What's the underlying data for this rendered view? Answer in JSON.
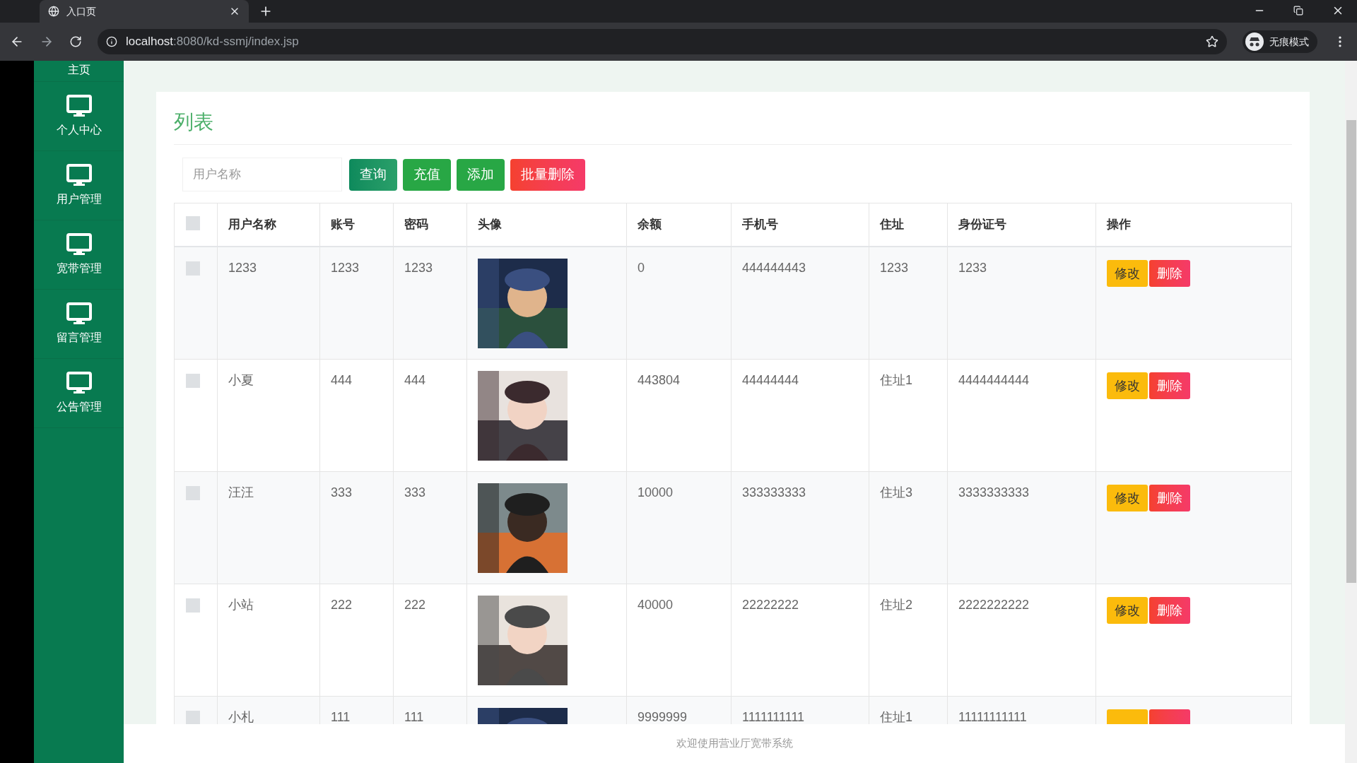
{
  "browser": {
    "tab_title": "入口页",
    "url_host": "localhost",
    "url_path": ":8080/kd-ssmj/index.jsp",
    "incognito_label": "无痕模式"
  },
  "sidebar": {
    "items": [
      {
        "label": "主页",
        "selected": false
      },
      {
        "label": "个人中心",
        "selected": false
      },
      {
        "label": "用户管理",
        "selected": false
      },
      {
        "label": "宽带管理",
        "selected": false
      },
      {
        "label": "留言管理",
        "selected": false
      },
      {
        "label": "公告管理",
        "selected": false
      }
    ]
  },
  "card": {
    "title": "列表",
    "search": {
      "placeholder": "用户名称"
    },
    "buttons": [
      {
        "label": "查询",
        "kind": "primary"
      },
      {
        "label": "充值",
        "kind": "success"
      },
      {
        "label": "添加",
        "kind": "success"
      },
      {
        "label": "批量删除",
        "kind": "danger"
      }
    ]
  },
  "table": {
    "header_checked": false,
    "columns": [
      "用户名称",
      "账号",
      "密码",
      "头像",
      "余额",
      "手机号",
      "住址",
      "身份证号",
      "操作"
    ],
    "rows": [
      {
        "checked": false,
        "name": "1233",
        "account": "1233",
        "password": "1233",
        "balance": "0",
        "phone": "444444443",
        "address": "1233",
        "id_number": "1233",
        "actions": [
          {
            "label": "修改",
            "kind": "warning"
          },
          {
            "label": "删除",
            "kind": "danger"
          }
        ]
      },
      {
        "checked": false,
        "name": "小夏",
        "account": "444",
        "password": "444",
        "balance": "443804",
        "phone": "44444444",
        "address": "住址1",
        "id_number": "4444444444",
        "actions": [
          {
            "label": "修改",
            "kind": "warning"
          },
          {
            "label": "删除",
            "kind": "danger"
          }
        ]
      },
      {
        "checked": false,
        "name": "汪汪",
        "account": "333",
        "password": "333",
        "balance": "10000",
        "phone": "333333333",
        "address": "住址3",
        "id_number": "3333333333",
        "actions": [
          {
            "label": "修改",
            "kind": "warning"
          },
          {
            "label": "删除",
            "kind": "danger"
          }
        ]
      },
      {
        "checked": false,
        "name": "小站",
        "account": "222",
        "password": "222",
        "balance": "40000",
        "phone": "22222222",
        "address": "住址2",
        "id_number": "2222222222",
        "actions": [
          {
            "label": "修改",
            "kind": "warning"
          },
          {
            "label": "删除",
            "kind": "danger"
          }
        ]
      },
      {
        "checked": false,
        "name": "小札",
        "account": "111",
        "password": "111",
        "balance": "9999999",
        "phone": "1111111111",
        "address": "住址1",
        "id_number": "11111111111",
        "actions": [
          {
            "kind": "warning"
          },
          {
            "kind": "danger"
          }
        ]
      }
    ]
  },
  "footer": "欢迎使用营业厅宽带系统"
}
